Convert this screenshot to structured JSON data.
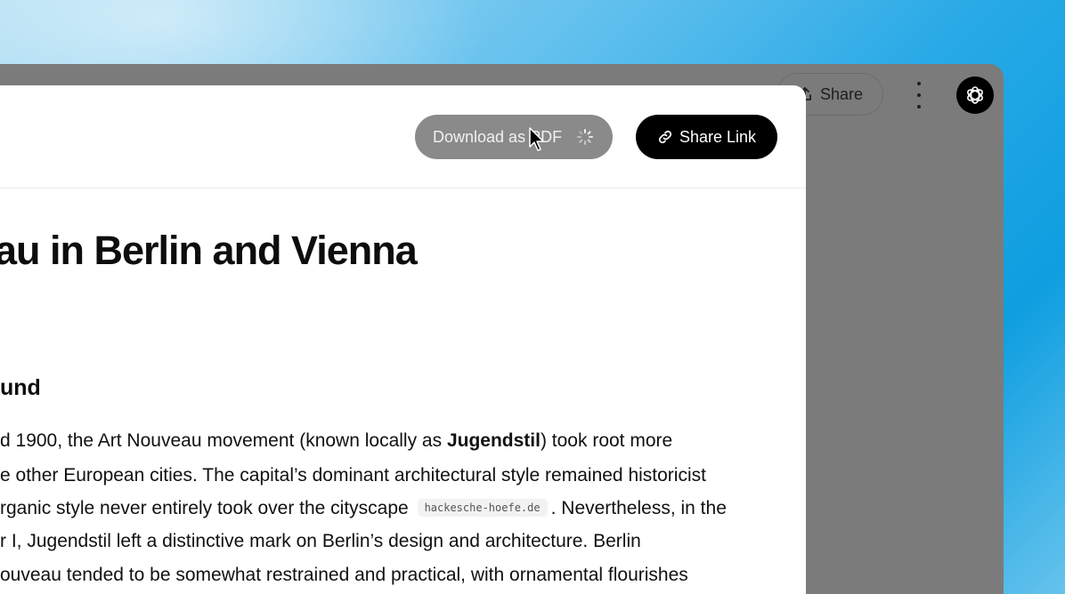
{
  "topbar": {
    "share_label": "Share"
  },
  "panel": {
    "download_label": "Download as PDF",
    "share_link_label": "Share Link"
  },
  "document": {
    "title": "au in Berlin and Vienna",
    "section_heading": "und",
    "lines": [
      {
        "before": "d 1900, the Art Nouveau movement (known locally as ",
        "bold": "Jugendstil",
        "after": ") took root more"
      },
      {
        "text": "e other European cities. The capital’s dominant architectural style remained historicist"
      },
      {
        "before": "rganic style never entirely took over the cityscape ",
        "chip": "hackesche-hoefe.de",
        "after": ". Nevertheless, in the"
      },
      {
        "text": "r I, Jugendstil left a distinctive mark on Berlin’s design and architecture. Berlin"
      },
      {
        "text": "ouveau tended to be somewhat restrained and practical, with ornamental flourishes"
      }
    ]
  },
  "colors": {
    "accent_button": "#000000",
    "disabled_button": "#8a8a8a",
    "window_overlay": "#7b7b7b"
  }
}
